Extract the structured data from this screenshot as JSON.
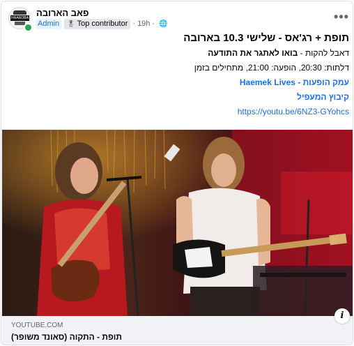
{
  "header": {
    "page_name": "פאב הארובה",
    "avatar_text": "HAAROBA",
    "role_badge": "Admin",
    "contributor_badge": "Top contributor",
    "time": "19h",
    "more_icon": "more-horizontal-icon"
  },
  "post": {
    "title": "תופת + רג'אס - שלישי 10.3 בארובה",
    "line1_prefix": "דאבל להקות - ",
    "line1_bold": "בואו לאתגר את התודעה",
    "line2": "דלתות: 20:30, הופעה: 21:00, מתחילים בזמן",
    "link1": "עמק הופעות - Haemek Lives",
    "link2": "קיבוץ המעפיל",
    "link3": "https://youtu.be/6NZ3-GYohcs"
  },
  "preview": {
    "domain": "YOUTUBE.COM",
    "title": "תופת - התקוה (סאונד משופר)",
    "info_icon": "info-icon"
  },
  "colors": {
    "link": "#216fdb",
    "admin_badge_bg": "#e7f3ff",
    "admin_badge_text": "#1b74e4",
    "online": "#31a24c",
    "preview_bg": "#f0f2f5"
  }
}
